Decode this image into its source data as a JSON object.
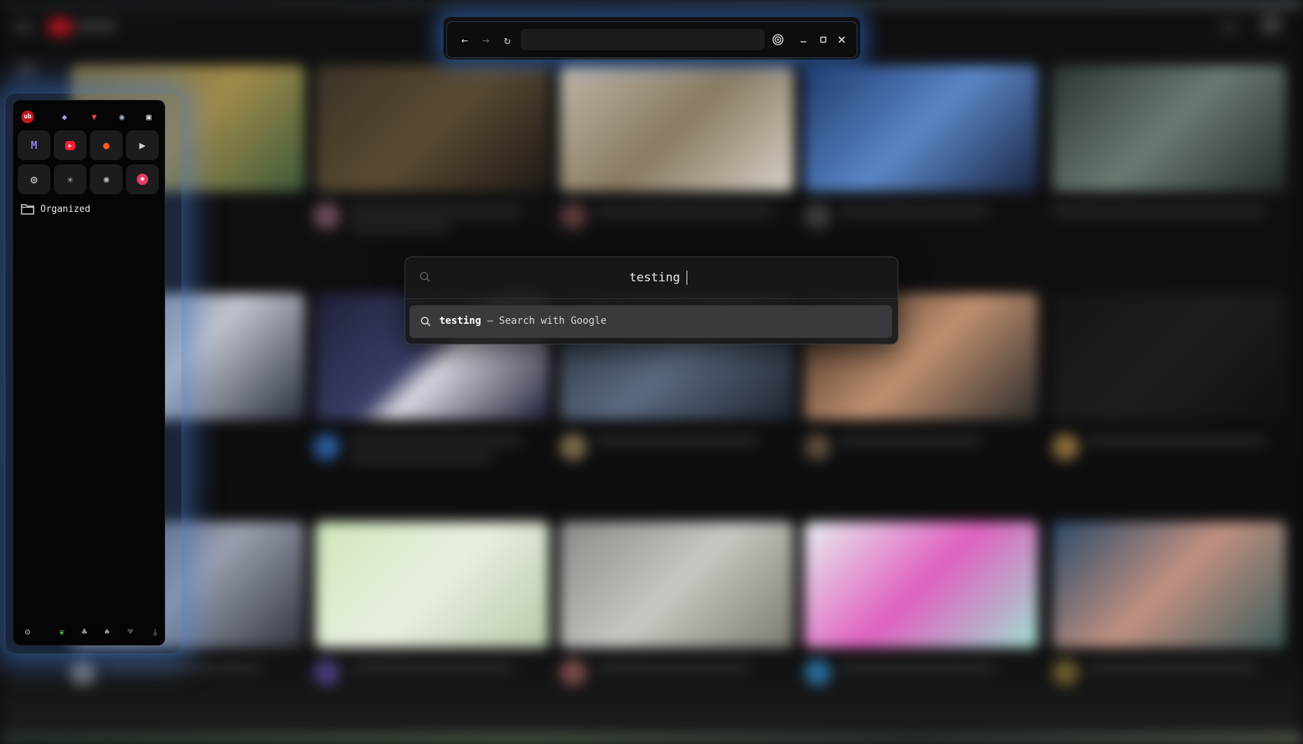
{
  "sidebar": {
    "extensions": [
      {
        "icon": "ublock-icon",
        "glyph": "ub",
        "color": "#c4161c"
      },
      {
        "icon": "bitwarden-icon",
        "glyph": "◆",
        "color": "#b59cf5"
      },
      {
        "icon": "tab-manager-icon",
        "glyph": "▼",
        "color": "#e04c4c"
      },
      {
        "icon": "privacy-badger-icon",
        "glyph": "◉",
        "color": "#9fb7d6"
      },
      {
        "icon": "reader-mode-icon",
        "glyph": "▣",
        "color": "#e0e0e0"
      }
    ],
    "pins": [
      {
        "icon": "proton-mail-icon",
        "glyph": "M",
        "color": "#8b7ee6"
      },
      {
        "icon": "youtube-icon",
        "glyph": "▶",
        "color": "#ff1e2d"
      },
      {
        "icon": "reddit-icon",
        "glyph": "●",
        "color": "#ff5a1f"
      },
      {
        "icon": "video-player-icon",
        "glyph": "▶",
        "color": "#cfcfcf"
      },
      {
        "icon": "github-icon",
        "glyph": "◎",
        "color": "#e6e6e6"
      },
      {
        "icon": "claude-icon",
        "glyph": "✳",
        "color": "#bdbdbd"
      },
      {
        "icon": "chatgpt-icon",
        "glyph": "✺",
        "color": "#bdbdbd"
      },
      {
        "icon": "music-icon",
        "glyph": "◉",
        "color": "#e23b66"
      }
    ],
    "folder": {
      "label": "Organized",
      "icon": "folder-icon"
    },
    "footer": [
      {
        "icon": "settings-icon",
        "glyph": "⚙"
      },
      {
        "icon": "leaf-icon",
        "glyph": "❦",
        "color": "#3fb950"
      },
      {
        "icon": "workspace-icon",
        "glyph": "♣"
      },
      {
        "icon": "workspace-icon-2",
        "glyph": "♠"
      },
      {
        "icon": "workspace-icon-3",
        "glyph": "♥",
        "color": "#444"
      },
      {
        "icon": "download-icon",
        "glyph": "⤓"
      }
    ]
  },
  "urlbar": {
    "url_value": "",
    "buttons": [
      "back-icon",
      "forward-icon",
      "reload-icon",
      "extension-icon",
      "minimize-icon",
      "maximize-icon",
      "close-icon"
    ]
  },
  "palette": {
    "query": "testing",
    "result": {
      "query": "testing",
      "suffix": " — Search with Google"
    }
  }
}
